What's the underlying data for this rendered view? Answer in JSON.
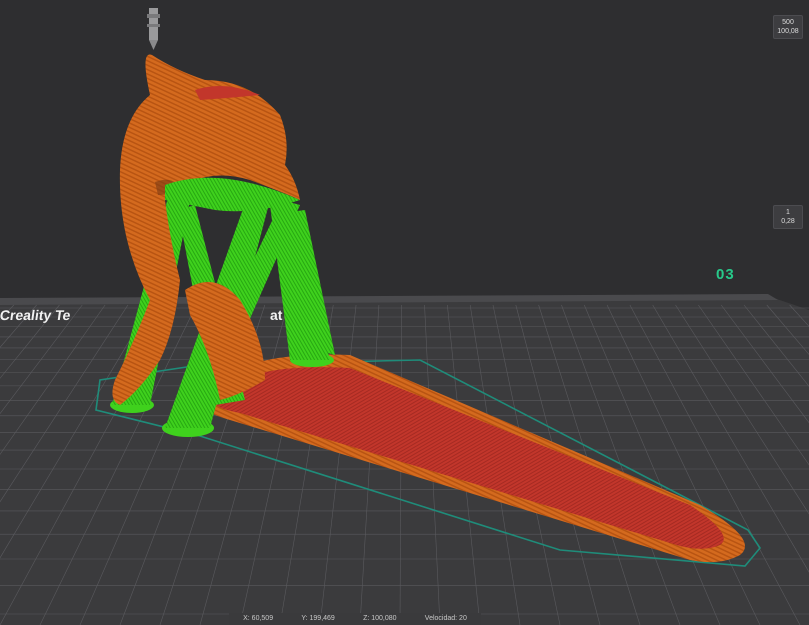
{
  "layer_slider": {
    "top_layer": "500",
    "top_height": "100,08",
    "bottom_layer": "1",
    "bottom_height": "0,28"
  },
  "plate": {
    "brand_text": "Creality Te",
    "brand_tail": "at",
    "build_number": "03"
  },
  "status": {
    "x": "X: 60,509",
    "y": "Y: 199,469",
    "z": "Z: 100,080",
    "speed": "Velocidad: 20"
  },
  "colors": {
    "background": "#2e2e30",
    "plate": "#3b3b3d",
    "grid": "#5a5a5e",
    "model_orange": "#d46a1e",
    "model_red": "#c0342a",
    "support_green": "#3fd11d",
    "skirt": "#1f8c7a",
    "accent_number": "#27c98a"
  },
  "icons": {
    "nozzle": "nozzle-icon"
  }
}
